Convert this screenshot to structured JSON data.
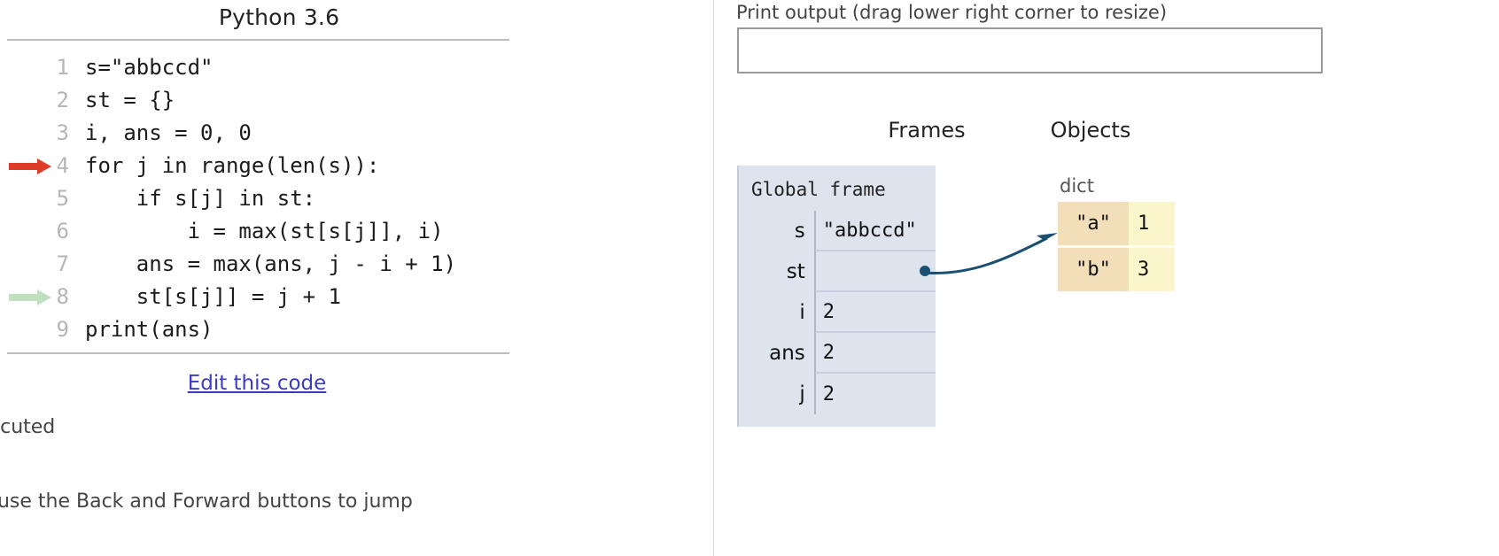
{
  "left": {
    "language_title": "Python 3.6",
    "code_lines": [
      {
        "number": "1",
        "text": "s=\"abbccd\"",
        "arrow": "none"
      },
      {
        "number": "2",
        "text": "st = {}",
        "arrow": "none"
      },
      {
        "number": "3",
        "text": "i, ans = 0, 0",
        "arrow": "none"
      },
      {
        "number": "4",
        "text": "for j in range(len(s)):",
        "arrow": "red"
      },
      {
        "number": "5",
        "text": "    if s[j] in st:",
        "arrow": "none"
      },
      {
        "number": "6",
        "text": "        i = max(st[s[j]], i)",
        "arrow": "none"
      },
      {
        "number": "7",
        "text": "    ans = max(ans, j - i + 1)",
        "arrow": "none"
      },
      {
        "number": "8",
        "text": "    st[s[j]] = j + 1",
        "arrow": "green"
      },
      {
        "number": "9",
        "text": "print(ans)",
        "arrow": "none"
      }
    ],
    "edit_link": "Edit this code",
    "status_line_1": "st executed",
    "status_line_2": "cute",
    "hint_line": "to set a breakpoint; use the Back and Forward buttons to jump"
  },
  "right": {
    "print_output_label": "Print output (drag lower right corner to resize)",
    "print_output_value": "",
    "print_output_placeholder": "",
    "frames_header": "Frames",
    "objects_header": "Objects",
    "global_frame": {
      "title": "Global frame",
      "variables": [
        {
          "name": "s",
          "value": "\"abbccd\"",
          "pointer": false
        },
        {
          "name": "st",
          "value": "",
          "pointer": true
        },
        {
          "name": "i",
          "value": "2",
          "pointer": false
        },
        {
          "name": "ans",
          "value": "2",
          "pointer": false
        },
        {
          "name": "j",
          "value": "2",
          "pointer": false
        }
      ]
    },
    "objects": [
      {
        "type": "dict",
        "entries": [
          {
            "key": "\"a\"",
            "value": "1"
          },
          {
            "key": "\"b\"",
            "value": "3"
          }
        ]
      }
    ]
  },
  "colors": {
    "frame_bg": "#dde4ee",
    "dict_key_bg": "#f2dfba",
    "dict_value_bg": "#faf5ca",
    "arrow_red": "#dd3c27",
    "arrow_green": "#bfdfc0",
    "connector": "#1b4f72",
    "link": "#3b3bc4"
  }
}
